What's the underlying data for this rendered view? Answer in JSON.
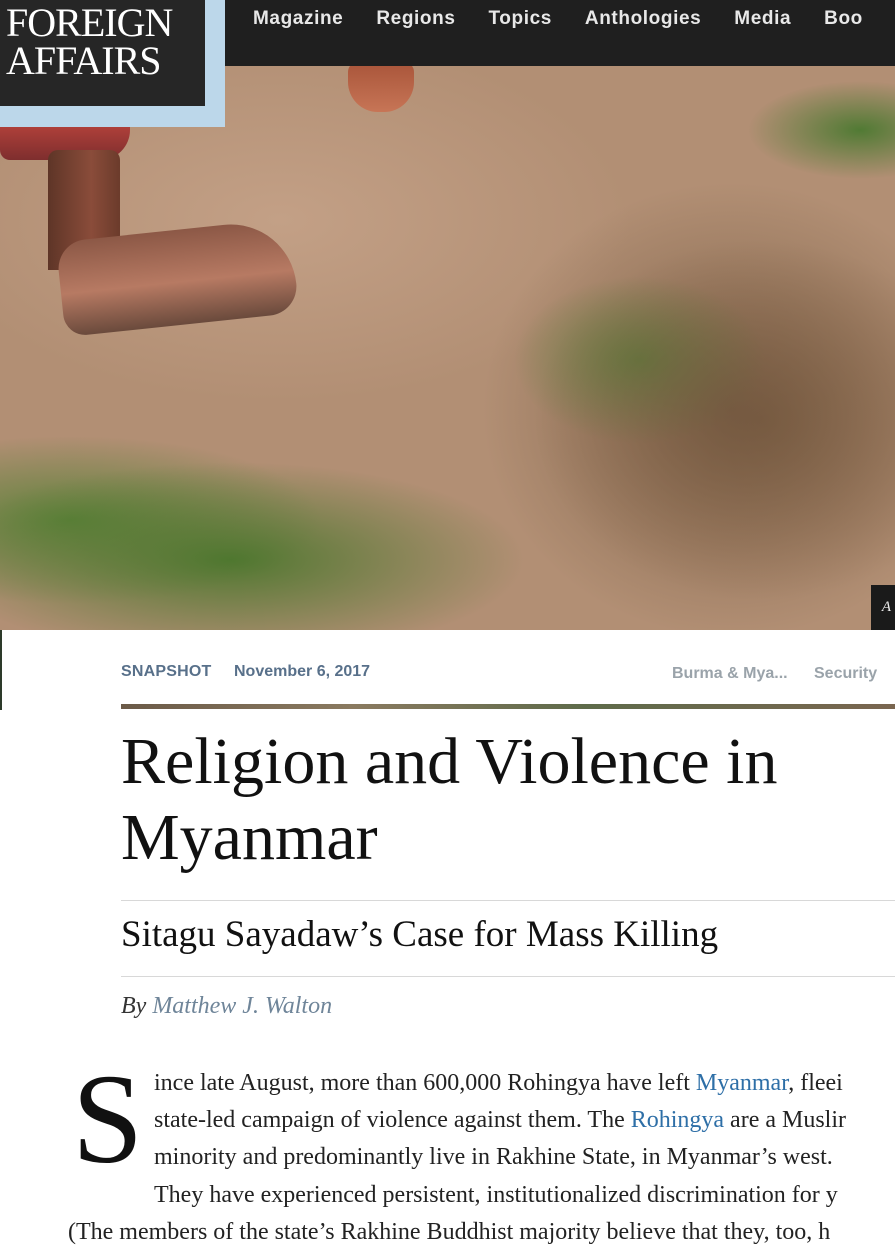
{
  "logo": {
    "line1": "FOREIGN",
    "line2": "AFFAIRS"
  },
  "nav": [
    {
      "label": "Magazine"
    },
    {
      "label": "Regions"
    },
    {
      "label": "Topics"
    },
    {
      "label": "Anthologies"
    },
    {
      "label": "Media"
    },
    {
      "label": "Boo"
    }
  ],
  "hero": {
    "caption_letter": "A"
  },
  "meta": {
    "tag": "SNAPSHOT",
    "date": "November 6, 2017",
    "topics": [
      "Burma & Mya...",
      "Security"
    ]
  },
  "article": {
    "title": "Religion and Violence in Myanmar",
    "subtitle": "Sitagu Sayadaw’s Case for Mass Killing",
    "byline_prefix": "By",
    "author": "Matthew J. Walton",
    "dropcap": "S",
    "lines": [
      {
        "before": "ince late August, more than 600,000 Rohingya have left ",
        "link": "Myanmar",
        "after": ", fleei"
      },
      {
        "before": "state-led campaign of violence against them. The ",
        "link": "Rohingya",
        "after": " are a Muslir"
      },
      {
        "before": "minority and predominantly live in Rakhine State, in Myanmar’s west.",
        "link": "",
        "after": ""
      },
      {
        "before": "They have experienced persistent, institutionalized discrimination for y",
        "link": "",
        "after": ""
      },
      {
        "before": "(The members of the state’s Rakhine Buddhist majority believe that they, too, h",
        "link": "",
        "after": ""
      }
    ]
  }
}
